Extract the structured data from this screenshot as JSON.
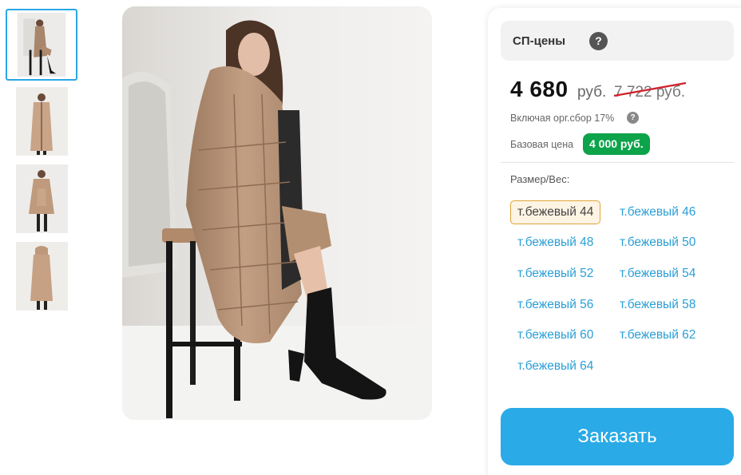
{
  "thumbnails": [
    {
      "label": "photo-1",
      "active": true
    },
    {
      "label": "photo-2",
      "active": false
    },
    {
      "label": "photo-3",
      "active": false
    },
    {
      "label": "photo-4",
      "active": false
    }
  ],
  "panel": {
    "sp_title": "СП-цены",
    "help_glyph": "?",
    "price": "4 680",
    "currency": "руб.",
    "old_price": "7 722 руб.",
    "fee_note": "Включая орг.сбор 17%",
    "base_price_label": "Базовая цена",
    "base_price_value": "4 000 руб.",
    "size_label": "Размер/Вес:",
    "sizes": [
      "т.бежевый 44",
      "т.бежевый 46",
      "т.бежевый 48",
      "т.бежевый 50",
      "т.бежевый 52",
      "т.бежевый 54",
      "т.бежевый 56",
      "т.бежевый 58",
      "т.бежевый 60",
      "т.бежевый 62",
      "т.бежевый 64"
    ],
    "selected_size": "т.бежевый 44",
    "order_button": "Заказать"
  },
  "colors": {
    "accent": "#2aaae6",
    "link": "#2a9fd6",
    "badge_green": "#0ca34a",
    "strike_red": "#d0202a"
  }
}
